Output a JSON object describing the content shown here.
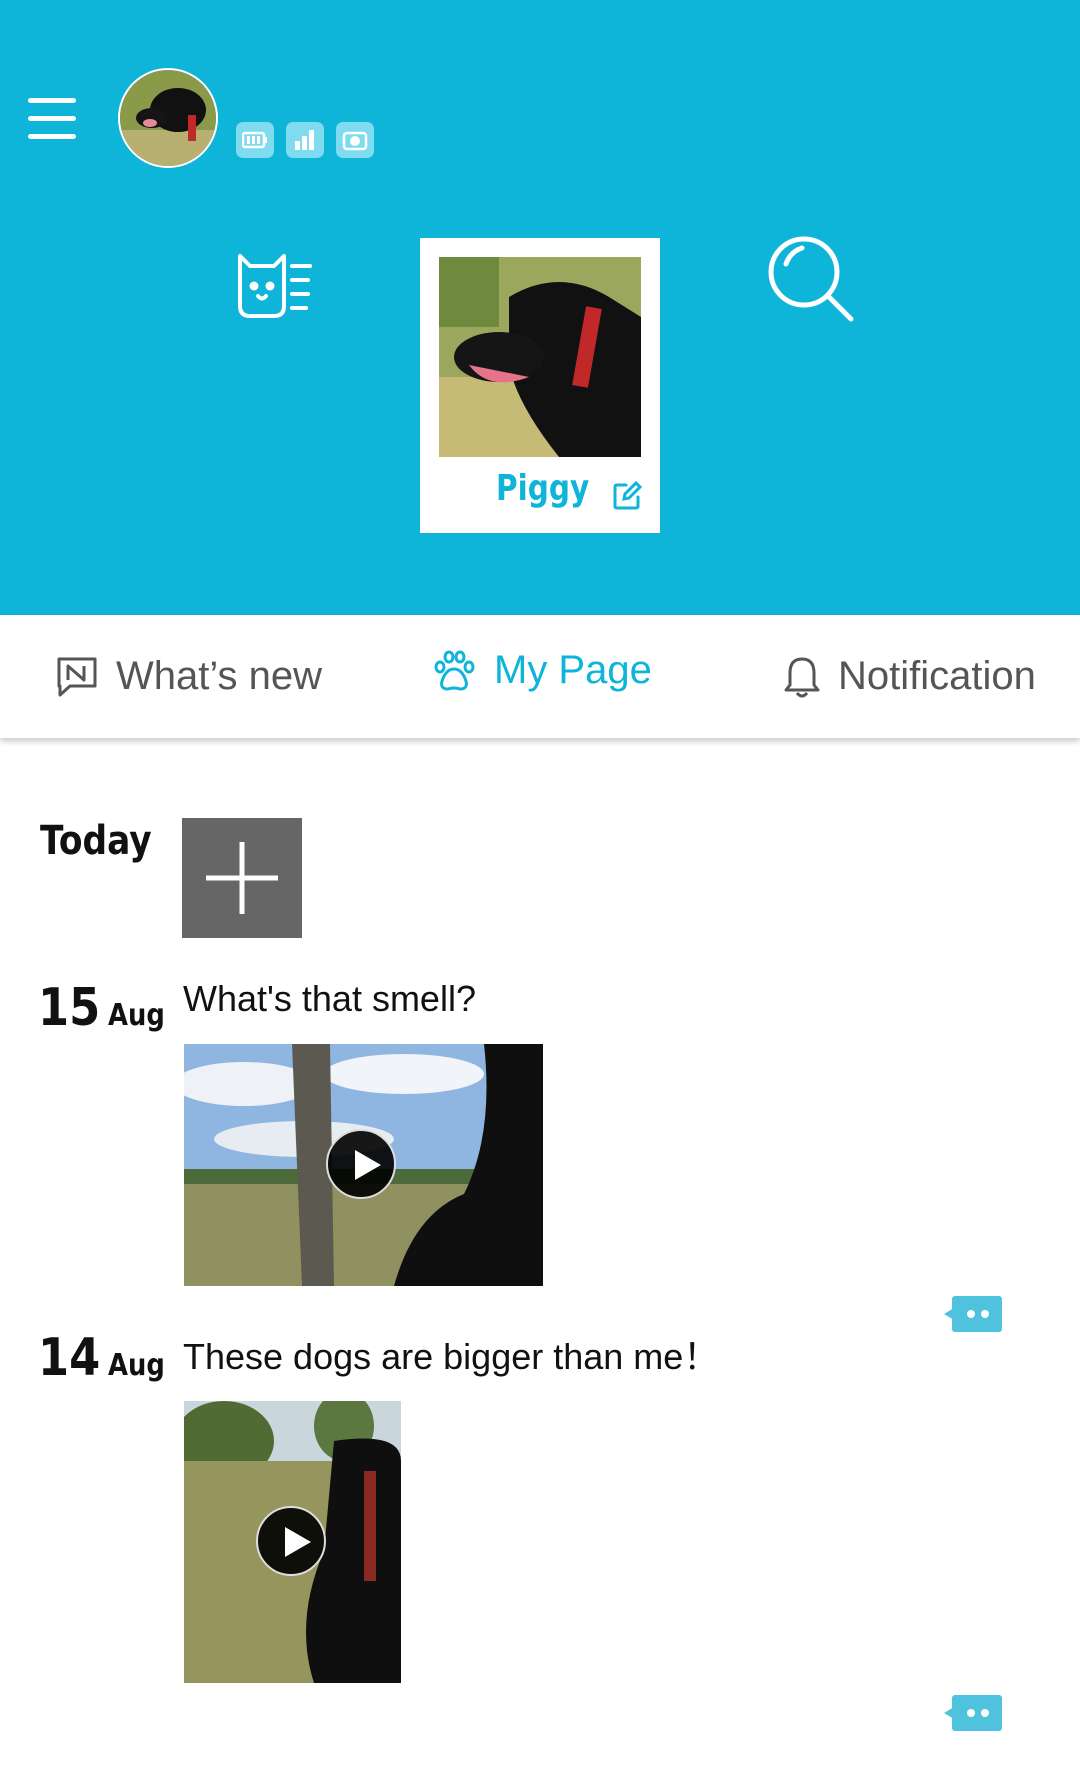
{
  "header": {
    "pet_name": "Piggy",
    "status_icons": [
      "battery-icon",
      "signal-icon",
      "camera-icon"
    ]
  },
  "tabs": [
    {
      "label": "What’s new",
      "icon": "news-icon",
      "active": false
    },
    {
      "label": "My Page",
      "icon": "paw-icon",
      "active": true
    },
    {
      "label": "Notification",
      "icon": "bell-icon",
      "active": false
    }
  ],
  "timeline": {
    "today_label": "Today",
    "posts": [
      {
        "day": "15",
        "month": "Aug",
        "title": "What's that smell?"
      },
      {
        "day": "14",
        "month": "Aug",
        "title": "These dogs are bigger than me！"
      }
    ]
  },
  "colors": {
    "accent": "#0fb4d9",
    "add_button": "#666666",
    "comment_bubble": "#4fc3dd"
  }
}
